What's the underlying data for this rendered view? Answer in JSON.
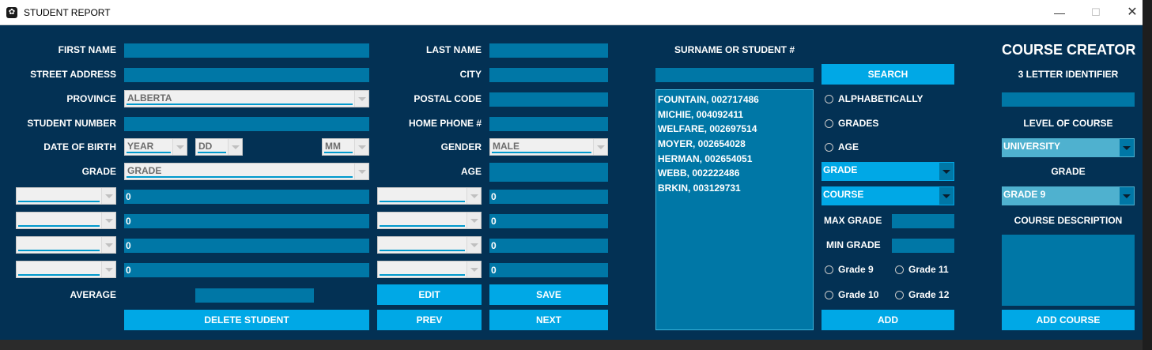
{
  "window": {
    "title": "STUDENT REPORT",
    "controls": {
      "minimize": "—",
      "maximize": "☐",
      "close": "✕"
    }
  },
  "student": {
    "first_name_label": "FIRST NAME",
    "last_name_label": "LAST NAME",
    "street_label": "STREET ADDRESS",
    "city_label": "CITY",
    "province_label": "PROVINCE",
    "province_value": "ALBERTA",
    "postal_label": "POSTAL CODE",
    "student_number_label": "STUDENT NUMBER",
    "home_phone_label": "HOME PHONE #",
    "dob_label": "DATE OF BIRTH",
    "dob_year": "YEAR",
    "dob_day": "DD",
    "dob_month": "MM",
    "gender_label": "GENDER",
    "gender_value": "MALE",
    "grade_label": "GRADE",
    "grade_value": "GRADE",
    "age_label": "AGE",
    "course_marks_left": [
      "0",
      "0",
      "0",
      "0"
    ],
    "course_marks_right": [
      "0",
      "0",
      "0",
      "0"
    ],
    "average_label": "AVERAGE"
  },
  "buttons": {
    "edit": "EDIT",
    "save": "SAVE",
    "delete_student": "DELETE STUDENT",
    "prev": "PREV",
    "next": "NEXT",
    "search": "SEARCH",
    "add": "ADD",
    "add_course": "ADD COURSE"
  },
  "search": {
    "label": "SURNAME OR STUDENT #",
    "results": [
      "FOUNTAIN, 002717486",
      "MICHIE, 004092411",
      "WELFARE, 002697514",
      "MOYER, 002654028",
      "HERMAN, 002654051",
      "WEBB, 002222486",
      "BRKIN, 003129731"
    ],
    "sort_options": [
      "ALPHABETICALLY",
      "GRADES",
      "AGE"
    ],
    "grade_filter": "GRADE",
    "course_filter": "COURSE",
    "max_grade_label": "MAX GRADE",
    "min_grade_label": "MIN GRADE",
    "grade_checks": [
      "Grade 9",
      "Grade 11",
      "Grade 10",
      "Grade 12"
    ]
  },
  "course_creator": {
    "title": "COURSE CREATOR",
    "identifier_label": "3 LETTER IDENTIFIER",
    "level_label": "LEVEL OF COURSE",
    "level_value": "UNIVERSITY",
    "grade_label": "GRADE",
    "grade_value": "GRADE 9",
    "description_label": "COURSE DESCRIPTION"
  },
  "colors": {
    "panel_bg": "#033154",
    "field": "#0077a6",
    "button": "#00a8e6",
    "combo_teal": "#4fb1cf",
    "text": "#ffffff"
  }
}
